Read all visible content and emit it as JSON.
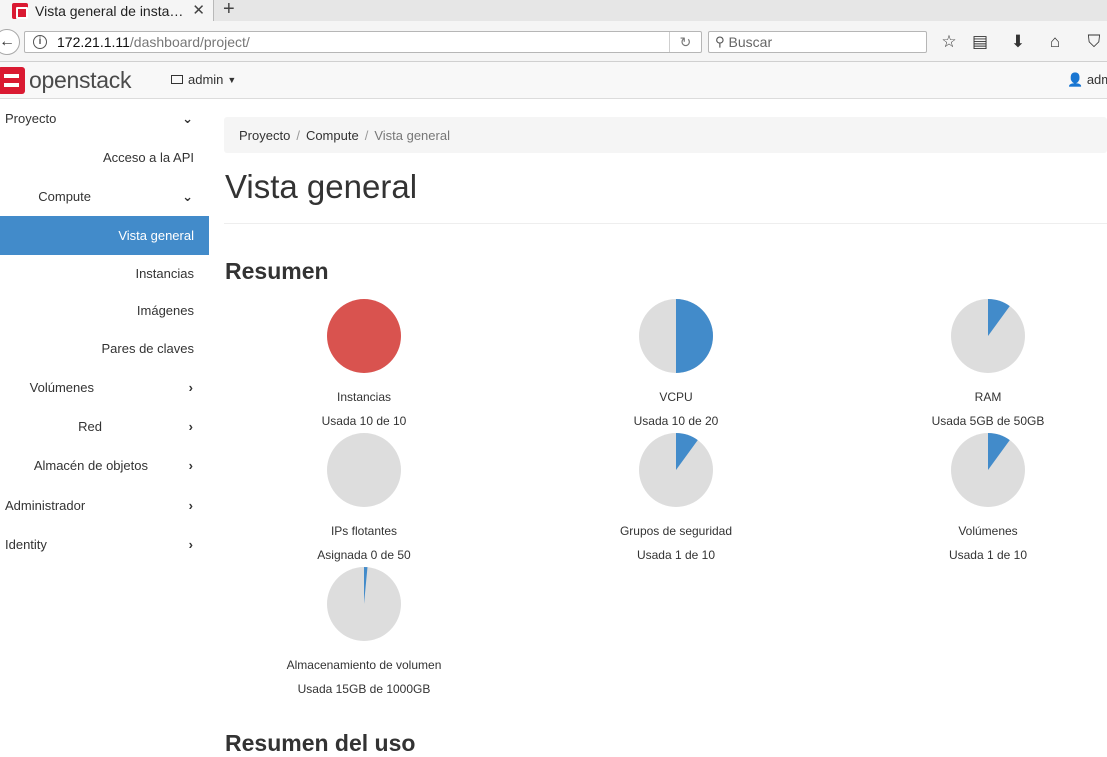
{
  "browser": {
    "tab_title": "Vista general de insta…",
    "url_host": "172.21.1.11",
    "url_path": "/dashboard/project/",
    "search_placeholder": "Buscar"
  },
  "header": {
    "logo_text": "openstack",
    "project": "admin",
    "user": "admin"
  },
  "sidebar": {
    "items": [
      {
        "label": "Proyecto",
        "chevron": "down"
      },
      {
        "label": "Acceso a la API"
      },
      {
        "label": "Compute",
        "chevron": "down"
      },
      {
        "label": "Vista general",
        "active": true
      },
      {
        "label": "Instancias"
      },
      {
        "label": "Imágenes"
      },
      {
        "label": "Pares de claves"
      },
      {
        "label": "Volúmenes",
        "chevron": "right"
      },
      {
        "label": "Red",
        "chevron": "right"
      },
      {
        "label": "Almacén de objetos",
        "chevron": "right"
      },
      {
        "label": "Administrador",
        "chevron": "right"
      },
      {
        "label": "Identity",
        "chevron": "right"
      }
    ]
  },
  "breadcrumb": [
    "Proyecto",
    "Compute",
    "Vista general"
  ],
  "page_title": "Vista general",
  "summary": {
    "title": "Resumen",
    "charts": [
      {
        "label": "Instancias",
        "usage": "Usada 10 de 10",
        "used": 10,
        "total": 10
      },
      {
        "label": "VCPU",
        "usage": "Usada 10 de 20",
        "used": 10,
        "total": 20
      },
      {
        "label": "RAM",
        "usage": "Usada 5GB de 50GB",
        "used": 5,
        "total": 50
      },
      {
        "label": "IPs flotantes",
        "usage": "Asignada 0 de 50",
        "used": 0,
        "total": 50
      },
      {
        "label": "Grupos de seguridad",
        "usage": "Usada 1 de 10",
        "used": 1,
        "total": 10
      },
      {
        "label": "Volúmenes",
        "usage": "Usada 1 de 10",
        "used": 1,
        "total": 10
      },
      {
        "label": "Almacenamiento de volumen",
        "usage": "Usada 15GB de 1000GB",
        "used": 15,
        "total": 1000
      }
    ]
  },
  "usage_title": "Resumen del uso",
  "colors": {
    "used": "#428bca",
    "full": "#d9534f",
    "free": "#dddddd",
    "sidebar_active": "#428bca"
  }
}
